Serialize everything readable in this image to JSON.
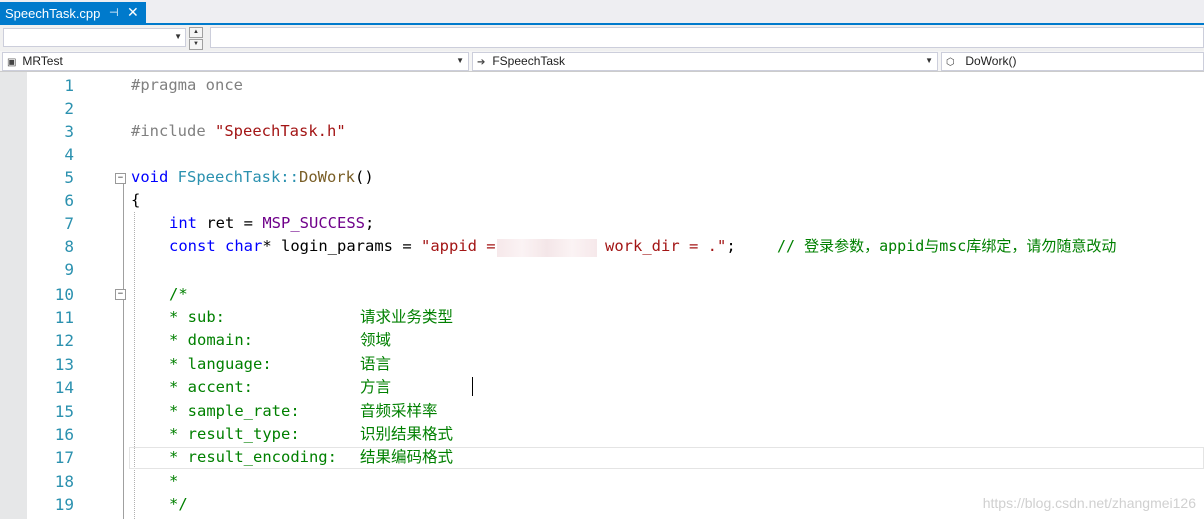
{
  "tab": {
    "title": "SpeechTask.cpp",
    "pin": "⊣",
    "close": "✕"
  },
  "nav": {
    "project": "MRTest",
    "scope": "FSpeechTask",
    "member": "DoWork()"
  },
  "code_lines": [
    {
      "num": "1"
    },
    {
      "num": "2"
    },
    {
      "num": "3"
    },
    {
      "num": "4"
    },
    {
      "num": "5"
    },
    {
      "num": "6"
    },
    {
      "num": "7"
    },
    {
      "num": "8"
    },
    {
      "num": "9"
    },
    {
      "num": "10"
    },
    {
      "num": "11"
    },
    {
      "num": "12"
    },
    {
      "num": "13"
    },
    {
      "num": "14"
    },
    {
      "num": "15"
    },
    {
      "num": "16"
    },
    {
      "num": "17"
    },
    {
      "num": "18"
    },
    {
      "num": "19"
    }
  ],
  "code": {
    "l1": "#pragma once",
    "l3_a": "#include ",
    "l3_b": "\"SpeechTask.h\"",
    "l5_a": "void",
    "l5_b": " FSpeechTask::",
    "l5_c": "DoWork",
    "l5_d": "()",
    "l6": "{",
    "l7_a": "int",
    "l7_b": " ret = ",
    "l7_c": "MSP_SUCCESS",
    "l7_d": ";",
    "l8_a": "const",
    "l8_b": " ",
    "l8_c": "char",
    "l8_d": "* login_params = ",
    "l8_e": "\"appid = ",
    "l8_f": "work_dir = .\"",
    "l8_g": ";",
    "l8_h": "// 登录参数，appid与msc库绑定，请勿随意改动",
    "l10": "/*",
    "l11_a": "* sub:",
    "l11_b": "请求业务类型",
    "l12_a": "* domain:",
    "l12_b": "领域",
    "l13_a": "* language:",
    "l13_b": "语言",
    "l14_a": "* accent:",
    "l14_b": "方言",
    "l15_a": "* sample_rate:",
    "l15_b": "音频采样率",
    "l16_a": "* result_type:",
    "l16_b": "识别结果格式",
    "l17_a": "* result_encoding:",
    "l17_b": "结果编码格式",
    "l18": "*",
    "l19": "*/"
  },
  "watermark": "https://blog.csdn.net/zhangmei126"
}
